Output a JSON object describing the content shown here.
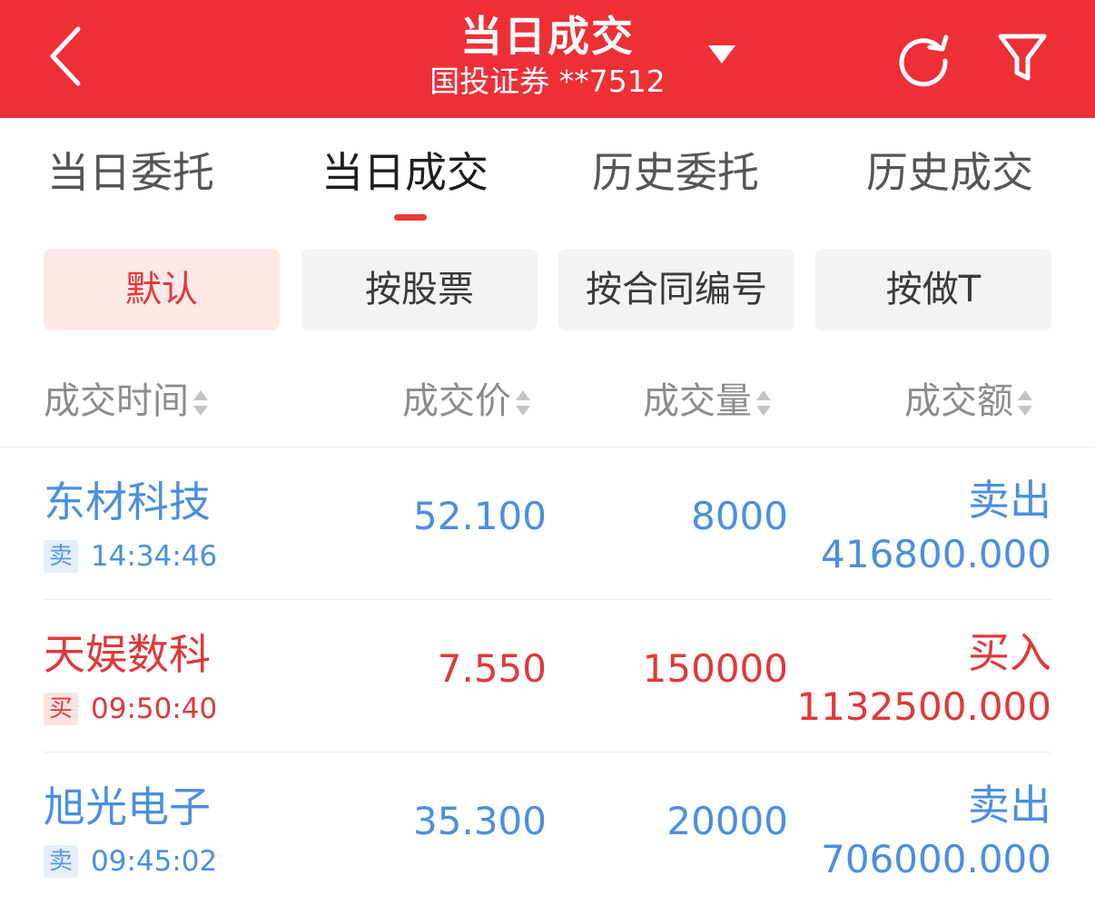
{
  "header": {
    "title": "当日成交",
    "account": "国投证券 **7512"
  },
  "tabs": [
    {
      "label": "当日委托"
    },
    {
      "label": "当日成交"
    },
    {
      "label": "历史委托"
    },
    {
      "label": "历史成交"
    }
  ],
  "sort_buttons": [
    {
      "label": "默认"
    },
    {
      "label": "按股票"
    },
    {
      "label": "按合同编号"
    },
    {
      "label": "按做T"
    }
  ],
  "columns": [
    {
      "label": "成交时间"
    },
    {
      "label": "成交价"
    },
    {
      "label": "成交量"
    },
    {
      "label": "成交额"
    }
  ],
  "trades": [
    {
      "name": "东材科技",
      "badge": "卖",
      "time": "14:34:46",
      "price": "52.100",
      "qty": "8000",
      "side": "卖出",
      "amount": "416800.000"
    },
    {
      "name": "天娱数科",
      "badge": "买",
      "time": "09:50:40",
      "price": "7.550",
      "qty": "150000",
      "side": "买入",
      "amount": "1132500.000"
    },
    {
      "name": "旭光电子",
      "badge": "卖",
      "time": "09:45:02",
      "price": "35.300",
      "qty": "20000",
      "side": "卖出",
      "amount": "706000.000"
    }
  ],
  "colors": {
    "header_bg": "#ee2f36",
    "sell": "#4a8fe0",
    "buy": "#e0383a"
  }
}
